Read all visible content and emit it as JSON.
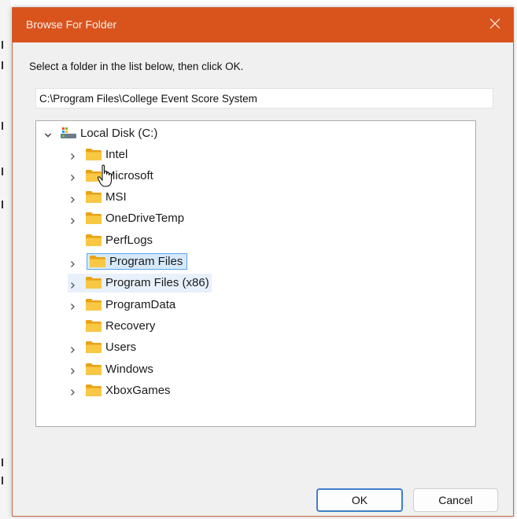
{
  "dialog": {
    "title": "Browse For Folder",
    "instruction": "Select a folder in the list below, then click OK.",
    "path_value": "C:\\Program Files\\College Event Score System",
    "ok_label": "OK",
    "cancel_label": "Cancel",
    "accent_color": "#d9531d",
    "icons": {
      "close": "close-icon",
      "root": "local-disk-icon",
      "item": "folder-icon"
    }
  },
  "tree": {
    "root": {
      "label": "Local Disk (C:)",
      "expanded": true
    },
    "items": [
      {
        "label": "Intel",
        "expandable": true
      },
      {
        "label": "Microsoft",
        "expandable": true
      },
      {
        "label": "MSI",
        "expandable": true
      },
      {
        "label": "OneDriveTemp",
        "expandable": true
      },
      {
        "label": "PerfLogs",
        "expandable": false
      },
      {
        "label": "Program Files",
        "expandable": true,
        "state": "selected"
      },
      {
        "label": "Program Files (x86)",
        "expandable": true,
        "state": "hovered"
      },
      {
        "label": "ProgramData",
        "expandable": true
      },
      {
        "label": "Recovery",
        "expandable": false
      },
      {
        "label": "Users",
        "expandable": true
      },
      {
        "label": "Windows",
        "expandable": true
      },
      {
        "label": "XboxGames",
        "expandable": true
      }
    ]
  }
}
